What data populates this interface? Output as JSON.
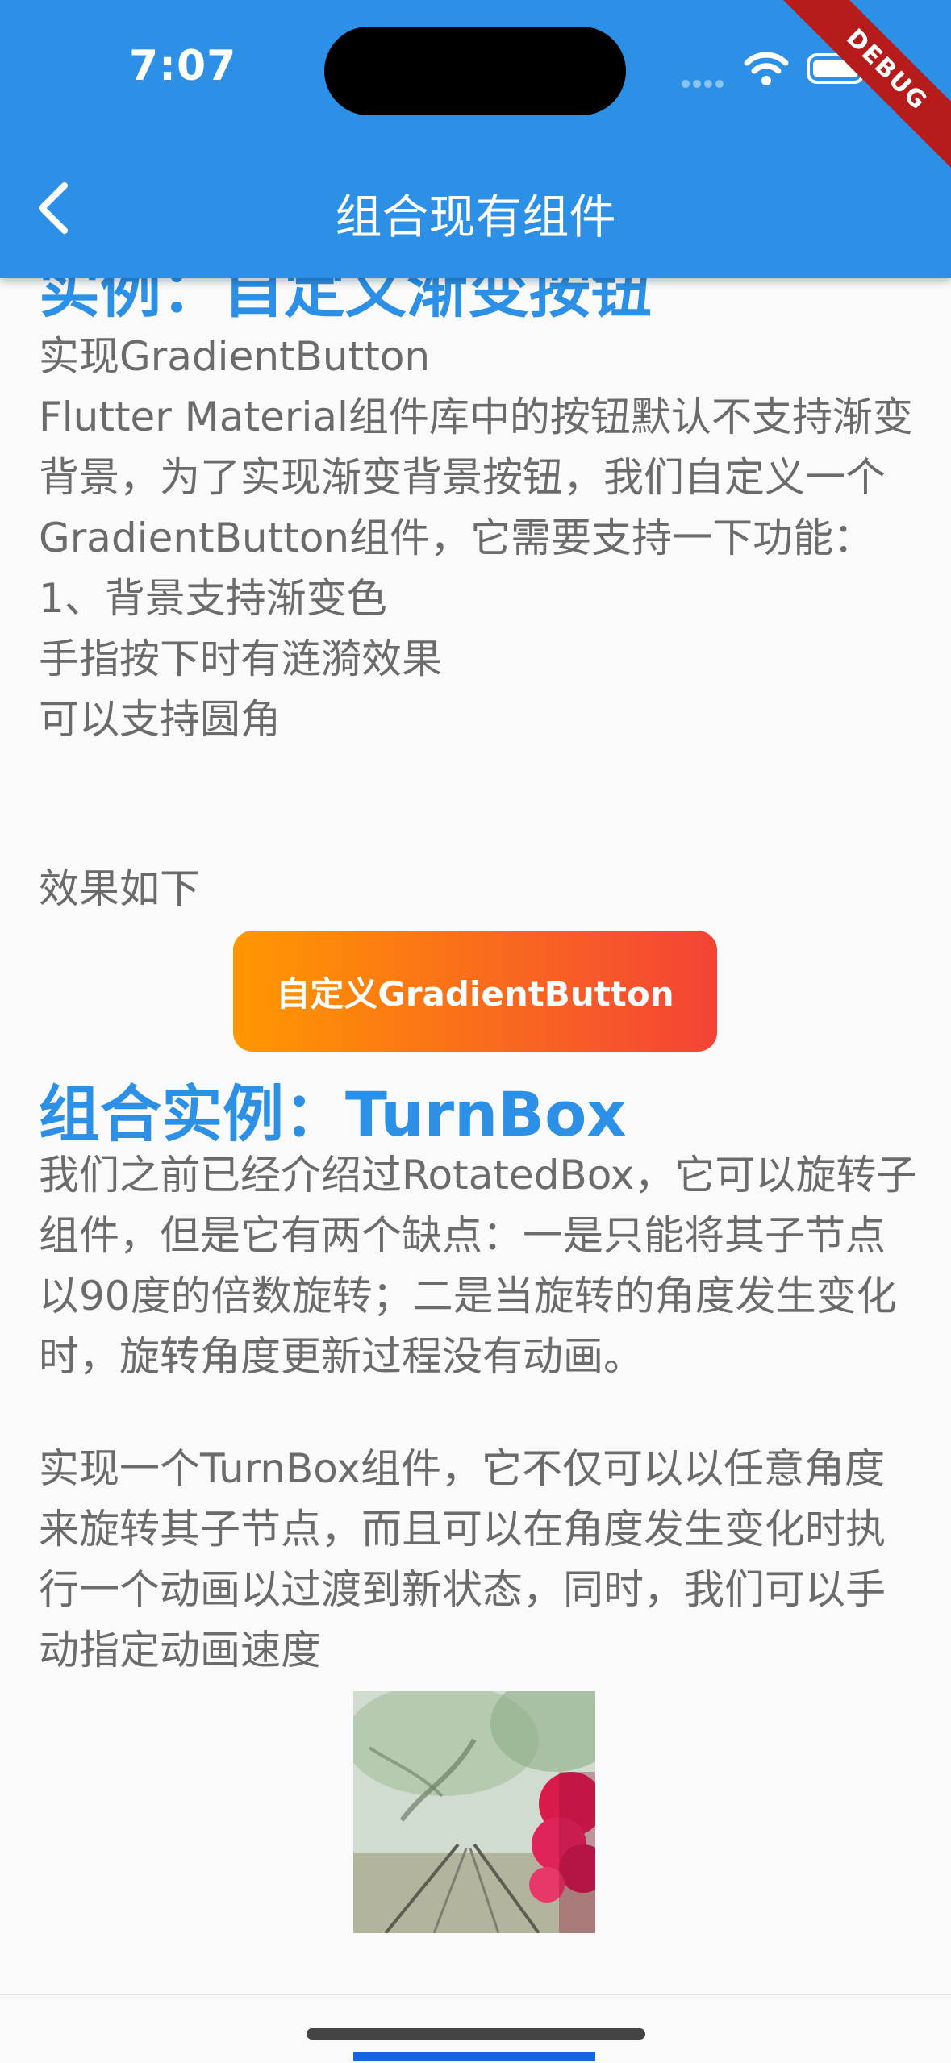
{
  "status_bar": {
    "time": "7:07"
  },
  "app_bar": {
    "title": "组合现有组件",
    "debug_label": "DEBUG"
  },
  "section1": {
    "heading": "实例：自定义渐变按钮",
    "paragraph": "实现GradientButton\nFlutter Material组件库中的按钮默认不支持渐变背景，为了实现渐变背景按钮，我们自定义一个GradientButton组件，它需要支持一下功能：\n1、背景支持渐变色\n手指按下时有涟漪效果\n可以支持圆角",
    "effect_label": "效果如下",
    "button_label": "自定义GradientButton",
    "gradient_colors": [
      "#ff9800",
      "#f44336"
    ]
  },
  "section2": {
    "heading": "组合实例：TurnBox",
    "paragraph1": "我们之前已经介绍过RotatedBox，它可以旋转子组件，但是它有两个缺点：一是只能将其子节点以90度的倍数旋转；二是当旋转的角度发生变化时，旋转角度更新过程没有动画。",
    "paragraph2": "实现一个TurnBox组件，它不仅可以以任意角度来旋转其子节点，而且可以在角度发生变化时执行一个动画以过渡到新状态，同时，我们可以手动指定动画速度"
  },
  "colors": {
    "primary": "#2b90e6",
    "text": "#6b6b6b",
    "background": "#fafafa"
  }
}
